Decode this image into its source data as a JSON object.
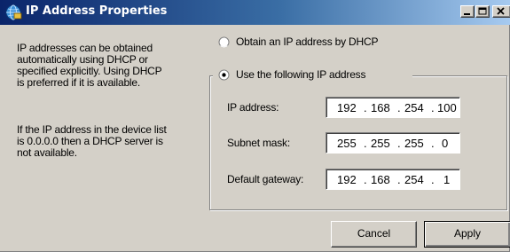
{
  "window": {
    "title": "IP Address Properties",
    "icon": "network-globe-icon",
    "controls": [
      "minimize-icon",
      "maximize-icon",
      "close-icon"
    ]
  },
  "description": {
    "paragraph1": [
      "IP addresses can be obtained",
      "automatically using DHCP or",
      "specified explicitly. Using DHCP",
      "is preferred if it is available."
    ],
    "paragraph2": [
      "If the IP address in the device list",
      "is 0.0.0.0 then a DHCP server is",
      "not available."
    ]
  },
  "options": {
    "dhcp_label": "Obtain an IP address by DHCP",
    "dhcp_selected": false,
    "static_label": "Use the following IP address",
    "static_selected": true
  },
  "fields": {
    "ip_label": "IP address:",
    "ip_value": [
      "192",
      "168",
      "254",
      "100"
    ],
    "subnet_label": "Subnet mask:",
    "subnet_value": [
      "255",
      "255",
      "255",
      "0"
    ],
    "gateway_label": "Default gateway:",
    "gateway_value": [
      "192",
      "168",
      "254",
      "1"
    ],
    "separator": "."
  },
  "buttons": {
    "cancel": "Cancel",
    "apply": "Apply"
  },
  "colors": {
    "titlebar_start": "#0a246a",
    "titlebar_end": "#a6caf0",
    "dialog_face": "#d4d0c8"
  }
}
